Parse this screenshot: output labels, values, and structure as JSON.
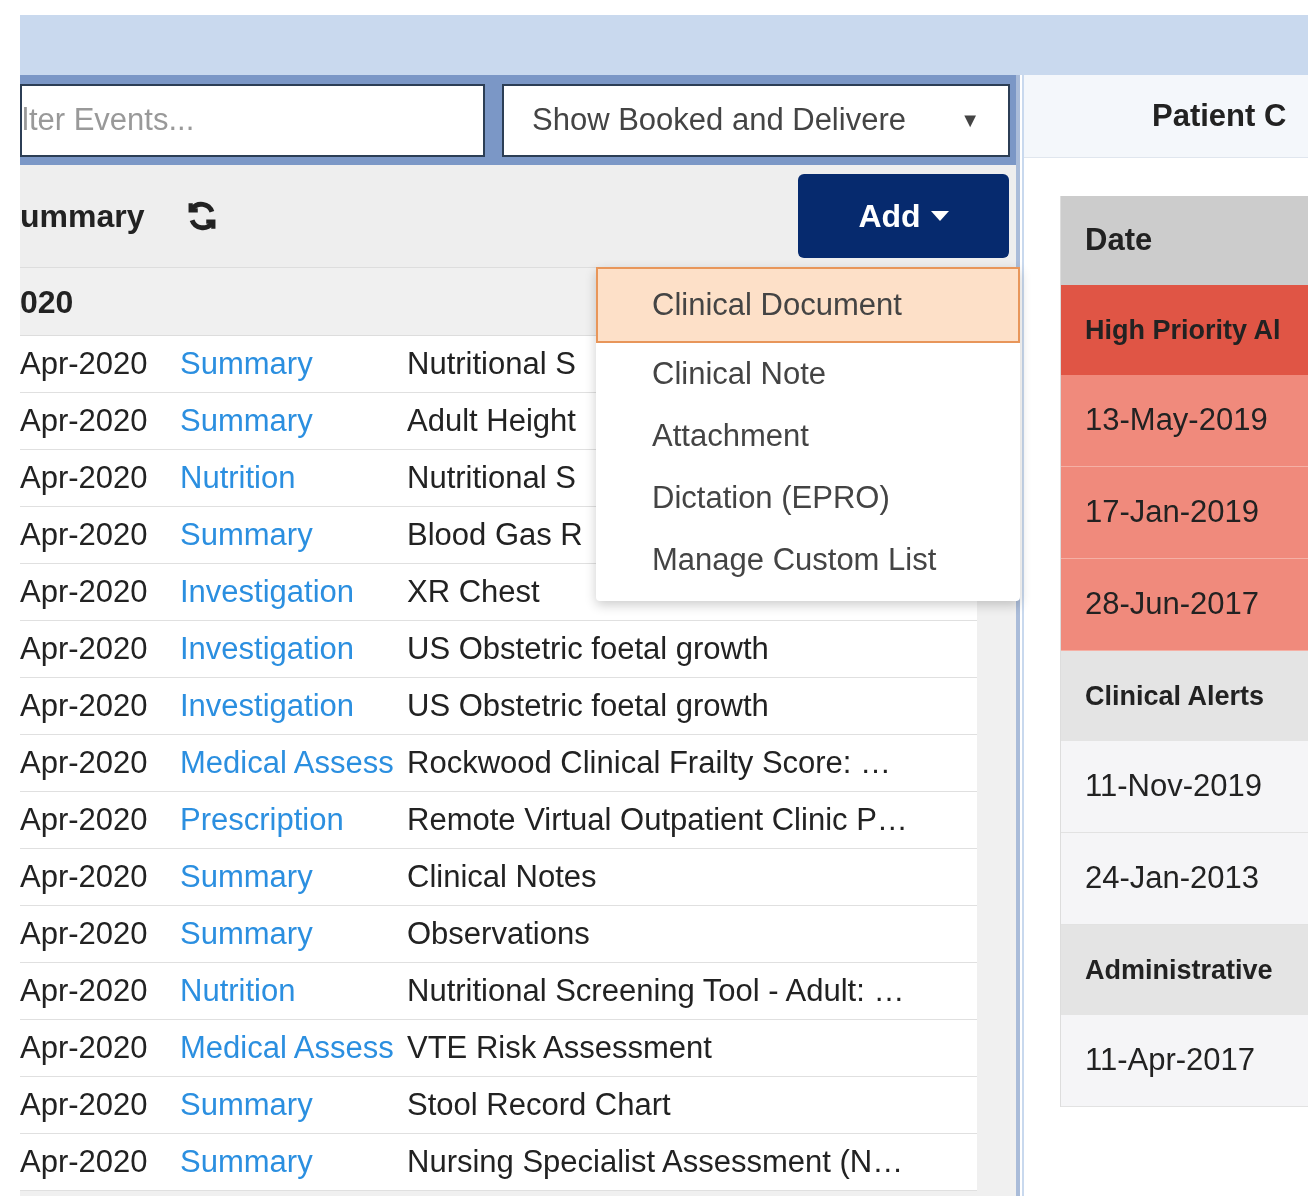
{
  "filter": {
    "placeholder": "lter Events..."
  },
  "show_select": {
    "value": "Show Booked and Delivere",
    "arrow": "▼"
  },
  "summary": {
    "title": "ummary",
    "add_button": "Add"
  },
  "group": {
    "title": "020"
  },
  "events": [
    {
      "date": "Apr-2020",
      "category": "Summary",
      "description": "Nutritional S"
    },
    {
      "date": "Apr-2020",
      "category": "Summary",
      "description": "Adult Height"
    },
    {
      "date": "Apr-2020",
      "category": "Nutrition",
      "description": "Nutritional S"
    },
    {
      "date": "Apr-2020",
      "category": "Summary",
      "description": "Blood Gas R"
    },
    {
      "date": "Apr-2020",
      "category": "Investigation",
      "description": "XR Chest"
    },
    {
      "date": "Apr-2020",
      "category": "Investigation",
      "description": "US Obstetric foetal growth"
    },
    {
      "date": "Apr-2020",
      "category": "Investigation",
      "description": "US Obstetric foetal growth"
    },
    {
      "date": "Apr-2020",
      "category": "Medical Assess",
      "description": "Rockwood Clinical Frailty Score: …"
    },
    {
      "date": "Apr-2020",
      "category": "Prescription",
      "description": "Remote Virtual Outpatient Clinic P…"
    },
    {
      "date": "Apr-2020",
      "category": "Summary",
      "description": "Clinical Notes"
    },
    {
      "date": "Apr-2020",
      "category": "Summary",
      "description": "Observations"
    },
    {
      "date": "Apr-2020",
      "category": "Nutrition",
      "description": "Nutritional Screening Tool - Adult: …"
    },
    {
      "date": "Apr-2020",
      "category": "Medical Assess",
      "description": "VTE Risk Assessment"
    },
    {
      "date": "Apr-2020",
      "category": "Summary",
      "description": "Stool Record Chart"
    },
    {
      "date": "Apr-2020",
      "category": "Summary",
      "description": "Nursing Specialist Assessment (N…"
    }
  ],
  "add_menu": [
    {
      "label": "Clinical Document",
      "selected": true
    },
    {
      "label": "Clinical Note",
      "selected": false
    },
    {
      "label": "Attachment",
      "selected": false
    },
    {
      "label": "Dictation (EPRO)",
      "selected": false
    },
    {
      "label": "Manage Custom List",
      "selected": false
    }
  ],
  "patient_panel": {
    "title": "Patient C",
    "column": "Date",
    "groups": [
      {
        "title": "High Priority Al",
        "kind": "high",
        "dates": [
          "13-May-2019",
          "17-Jan-2019",
          "28-Jun-2017"
        ]
      },
      {
        "title": "Clinical Alerts",
        "kind": "normal",
        "dates": [
          "11-Nov-2019",
          "24-Jan-2013"
        ]
      },
      {
        "title": "Administrative",
        "kind": "normal",
        "dates": [
          "11-Apr-2017"
        ]
      }
    ]
  }
}
